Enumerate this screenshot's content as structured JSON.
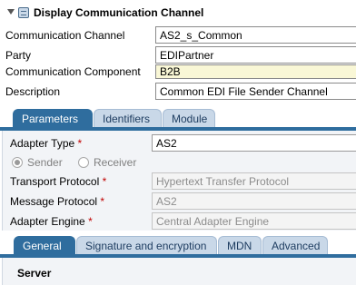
{
  "title": "Display Communication Channel",
  "header": {
    "fields": [
      {
        "label": "Communication Channel",
        "value": "AS2_s_Common"
      },
      {
        "label": "Party",
        "value": "EDIPartner"
      },
      {
        "label": "Communication Component",
        "value": "B2B"
      },
      {
        "label": "Description",
        "value": "Common EDI File Sender Channel"
      }
    ]
  },
  "tabs": [
    {
      "label": "Parameters",
      "active": true
    },
    {
      "label": "Identifiers",
      "active": false
    },
    {
      "label": "Module",
      "active": false
    }
  ],
  "params": {
    "adapter_type_label": "Adapter Type",
    "adapter_type_value": "AS2",
    "required_mark": "*",
    "direction": {
      "sender_label": "Sender",
      "receiver_label": "Receiver",
      "selected": "Sender"
    },
    "transport_protocol_label": "Transport Protocol",
    "transport_protocol_value": "Hypertext Transfer Protocol",
    "message_protocol_label": "Message Protocol",
    "message_protocol_value": "AS2",
    "adapter_engine_label": "Adapter Engine",
    "adapter_engine_value": "Central Adapter Engine"
  },
  "subtabs": [
    {
      "label": "General",
      "active": true
    },
    {
      "label": "Signature and encryption",
      "active": false
    },
    {
      "label": "MDN",
      "active": false
    },
    {
      "label": "Advanced",
      "active": false
    }
  ],
  "general": {
    "section_title": "Server"
  },
  "colors": {
    "tab_active": "#2f6d9e",
    "tab_inactive": "#c9d8e8",
    "required": "#c00000",
    "panel_bg": "#f2f4f7"
  }
}
